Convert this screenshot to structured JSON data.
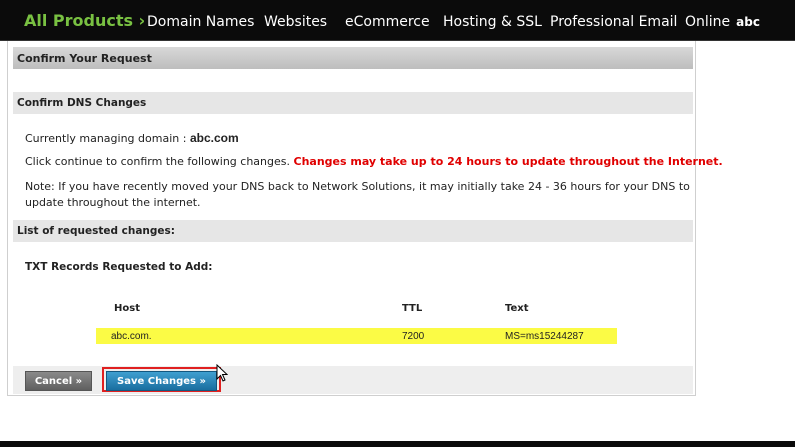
{
  "nav": {
    "all_products": "All Products ›",
    "items": [
      "Domain Names",
      "Websites",
      "eCommerce",
      "Hosting & SSL",
      "Professional Email",
      "Online"
    ],
    "badge": "abc"
  },
  "page": {
    "header": "Confirm Your Request",
    "dns_section_title": "Confirm DNS Changes",
    "managing_label": "Currently managing domain :",
    "managing_domain": "abc.com",
    "confirm_text": "Click continue to confirm the following changes.",
    "warning_text": "Changes may take up to 24 hours to update throughout the Internet.",
    "note_line1": "Note: If you have recently moved your DNS back to Network Solutions, it may initially take 24 - 36 hours for your DNS to",
    "note_line2": "update throughout the internet.",
    "list_title": "List of requested changes:",
    "txt_title": "TXT Records Requested to Add:"
  },
  "table": {
    "headers": [
      "Host",
      "TTL",
      "Text"
    ],
    "rows": [
      {
        "host": "abc.com.",
        "ttl": "7200",
        "text": "MS=ms15244287"
      }
    ]
  },
  "buttons": {
    "cancel": "Cancel »",
    "save": "Save Changes »"
  },
  "colors": {
    "nav_bg": "#0b0b0b",
    "nav_accent": "#79c142",
    "warning": "#e00000",
    "highlight": "#fbfb45",
    "save_button": "#1a6e9f",
    "save_outline": "#e02020"
  }
}
